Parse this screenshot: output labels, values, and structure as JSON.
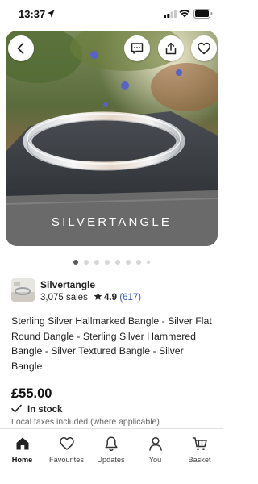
{
  "status_bar": {
    "time": "13:37"
  },
  "hero": {
    "caption": "SILVERTANGLE",
    "slide_count": 8,
    "active_slide": 1
  },
  "shop": {
    "name": "Silvertangle",
    "sales": "3,075 sales",
    "rating": "4.9",
    "review_count": "(617)"
  },
  "listing": {
    "title": "Sterling Silver Hallmarked Bangle - Silver Flat Round Bangle - Sterling Silver Hammered Bangle - Silver Textured Bangle - Silver Bangle",
    "price": "£55.00",
    "stock": "In stock",
    "taxes": "Local taxes included (where applicable)"
  },
  "nav": {
    "items": [
      {
        "label": "Home",
        "icon": "home-icon"
      },
      {
        "label": "Favourites",
        "icon": "heart-icon"
      },
      {
        "label": "Updates",
        "icon": "bell-icon"
      },
      {
        "label": "You",
        "icon": "person-icon"
      },
      {
        "label": "Basket",
        "icon": "basket-icon"
      }
    ]
  },
  "colors": {
    "link_blue": "#3b57c4",
    "dot_active": "#595959",
    "dot_inactive": "#d6d6d6"
  }
}
